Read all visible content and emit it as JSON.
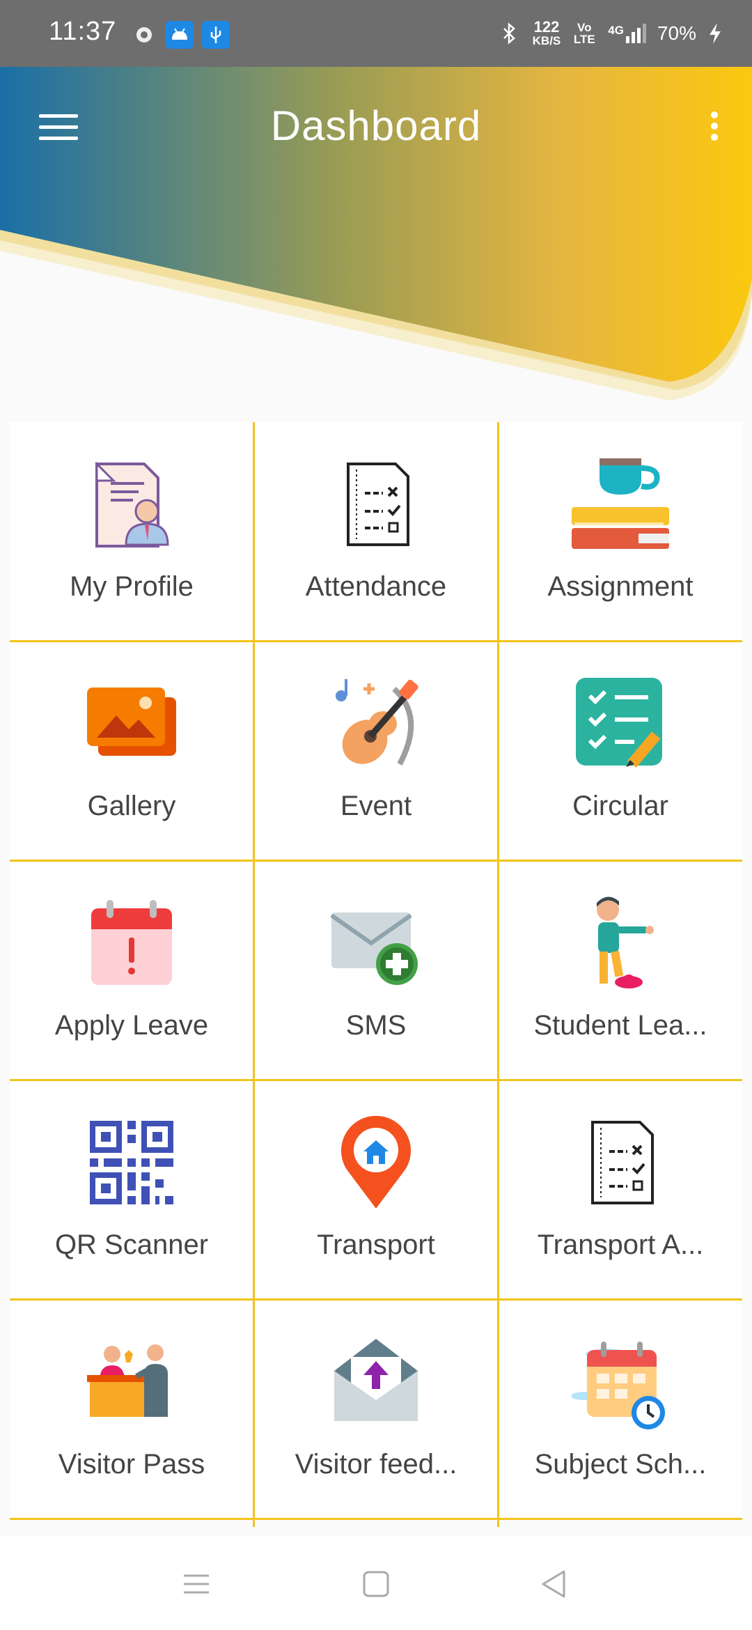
{
  "status_bar": {
    "time": "11:37",
    "net_speed_value": "122",
    "net_speed_unit": "KB/S",
    "volte": "Vo LTE",
    "signal": "4G",
    "battery": "70%"
  },
  "header": {
    "title": "Dashboard",
    "gradient_start": "#1a6fa6",
    "gradient_end": "#f8c814"
  },
  "grid": {
    "line_color": "#f2c419",
    "items": [
      {
        "label": "My Profile",
        "icon": "profile-document-icon"
      },
      {
        "label": "Attendance",
        "icon": "checklist-document-icon"
      },
      {
        "label": "Assignment",
        "icon": "books-cup-icon"
      },
      {
        "label": "Gallery",
        "icon": "gallery-photos-icon"
      },
      {
        "label": "Event",
        "icon": "guitar-music-icon"
      },
      {
        "label": "Circular",
        "icon": "checklist-pencil-icon"
      },
      {
        "label": "Apply Leave",
        "icon": "calendar-alert-icon"
      },
      {
        "label": "SMS",
        "icon": "mail-add-icon"
      },
      {
        "label": "Student Lea...",
        "icon": "student-leaving-icon"
      },
      {
        "label": "QR Scanner",
        "icon": "qr-code-icon"
      },
      {
        "label": "Transport",
        "icon": "map-pin-home-icon"
      },
      {
        "label": "Transport A...",
        "icon": "checklist-document-icon"
      },
      {
        "label": "Visitor Pass",
        "icon": "reception-desk-icon"
      },
      {
        "label": "Visitor feed...",
        "icon": "envelope-upload-icon"
      },
      {
        "label": "Subject Sch...",
        "icon": "calendar-clock-icon"
      }
    ]
  }
}
